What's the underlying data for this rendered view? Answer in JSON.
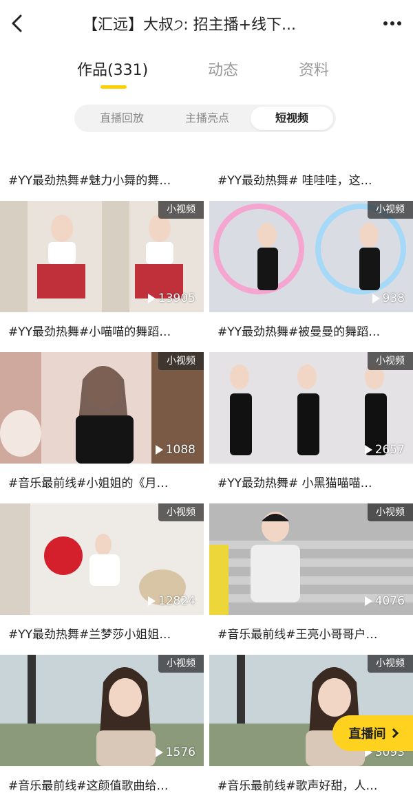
{
  "header": {
    "title": "【汇远】大叔੭: 招主播+线下...",
    "back_icon": "chevron-left-icon",
    "more_icon": "more-dots-icon"
  },
  "tabs": [
    {
      "label": "作品(331)",
      "active": true
    },
    {
      "label": "动态",
      "active": false
    },
    {
      "label": "资料",
      "active": false
    }
  ],
  "segments": [
    {
      "label": "直播回放",
      "active": false
    },
    {
      "label": "主播亮点",
      "active": false
    },
    {
      "label": "短视频",
      "active": true
    }
  ],
  "videos": [
    {
      "title": "#YY最劲热舞#魅力小舞的舞…",
      "badge": "小视频",
      "views": "13905"
    },
    {
      "title": "#YY最劲热舞# 哇哇哇，这…",
      "badge": "小视频",
      "views": "938"
    },
    {
      "title": "#YY最劲热舞#小喵喵的舞蹈…",
      "badge": "小视频",
      "views": "1088"
    },
    {
      "title": "#YY最劲热舞#被曼曼的舞蹈…",
      "badge": "小视频",
      "views": "2657"
    },
    {
      "title": "#音乐最前线#小姐姐的《月…",
      "badge": "小视频",
      "views": "12824"
    },
    {
      "title": "#YY最劲热舞# 小黑猫喵喵…",
      "badge": "小视频",
      "views": "4076"
    },
    {
      "title": "#YY最劲热舞#兰梦莎小姐姐…",
      "badge": "小视频",
      "views": "1576"
    },
    {
      "title": "#音乐最前线#王亮小哥哥户…",
      "badge": "小视频",
      "views": "3093"
    },
    {
      "title": "#音乐最前线#这颜值歌曲给…",
      "badge": "",
      "views": ""
    },
    {
      "title": "#音乐最前线#歌声好甜，人…",
      "badge": "",
      "views": ""
    }
  ],
  "live_button": {
    "label": "直播间"
  },
  "colors": {
    "accent": "#ffcf00",
    "badge_bg": "#282828"
  }
}
